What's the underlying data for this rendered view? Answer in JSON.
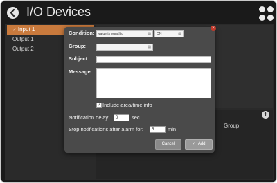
{
  "header": {
    "title": "I/O Devices",
    "back_icon": "back-arrow-icon",
    "apps_icon": "apps-grid-icon"
  },
  "devices": {
    "items": [
      {
        "label": "Input 1",
        "selected": true
      },
      {
        "label": "Output 1",
        "selected": false
      },
      {
        "label": "Output 2",
        "selected": false
      }
    ]
  },
  "table": {
    "group_header": "Group"
  },
  "dialog": {
    "condition_label": "Condition:",
    "condition_value": "value is equal to",
    "state_value": "ON",
    "group_label": "Group:",
    "group_value": "",
    "subject_label": "Subject:",
    "subject_value": "",
    "message_label": "Message:",
    "message_value": "",
    "include_checked": "✓",
    "include_label": "Include area/time info",
    "delay_label": "Notification delay:",
    "delay_value": "0",
    "delay_unit": "sec",
    "stop_label": "Stop notifications after alarm for:",
    "stop_value": "5",
    "stop_unit": "min",
    "cancel_label": "Cancel",
    "add_label": "Add",
    "add_check": "✓",
    "close_glyph": "×"
  },
  "colors": {
    "accent": "#c97a3d",
    "background": "#1a1a1a",
    "dialog": "#4a4a4a",
    "close": "#c0392b"
  }
}
